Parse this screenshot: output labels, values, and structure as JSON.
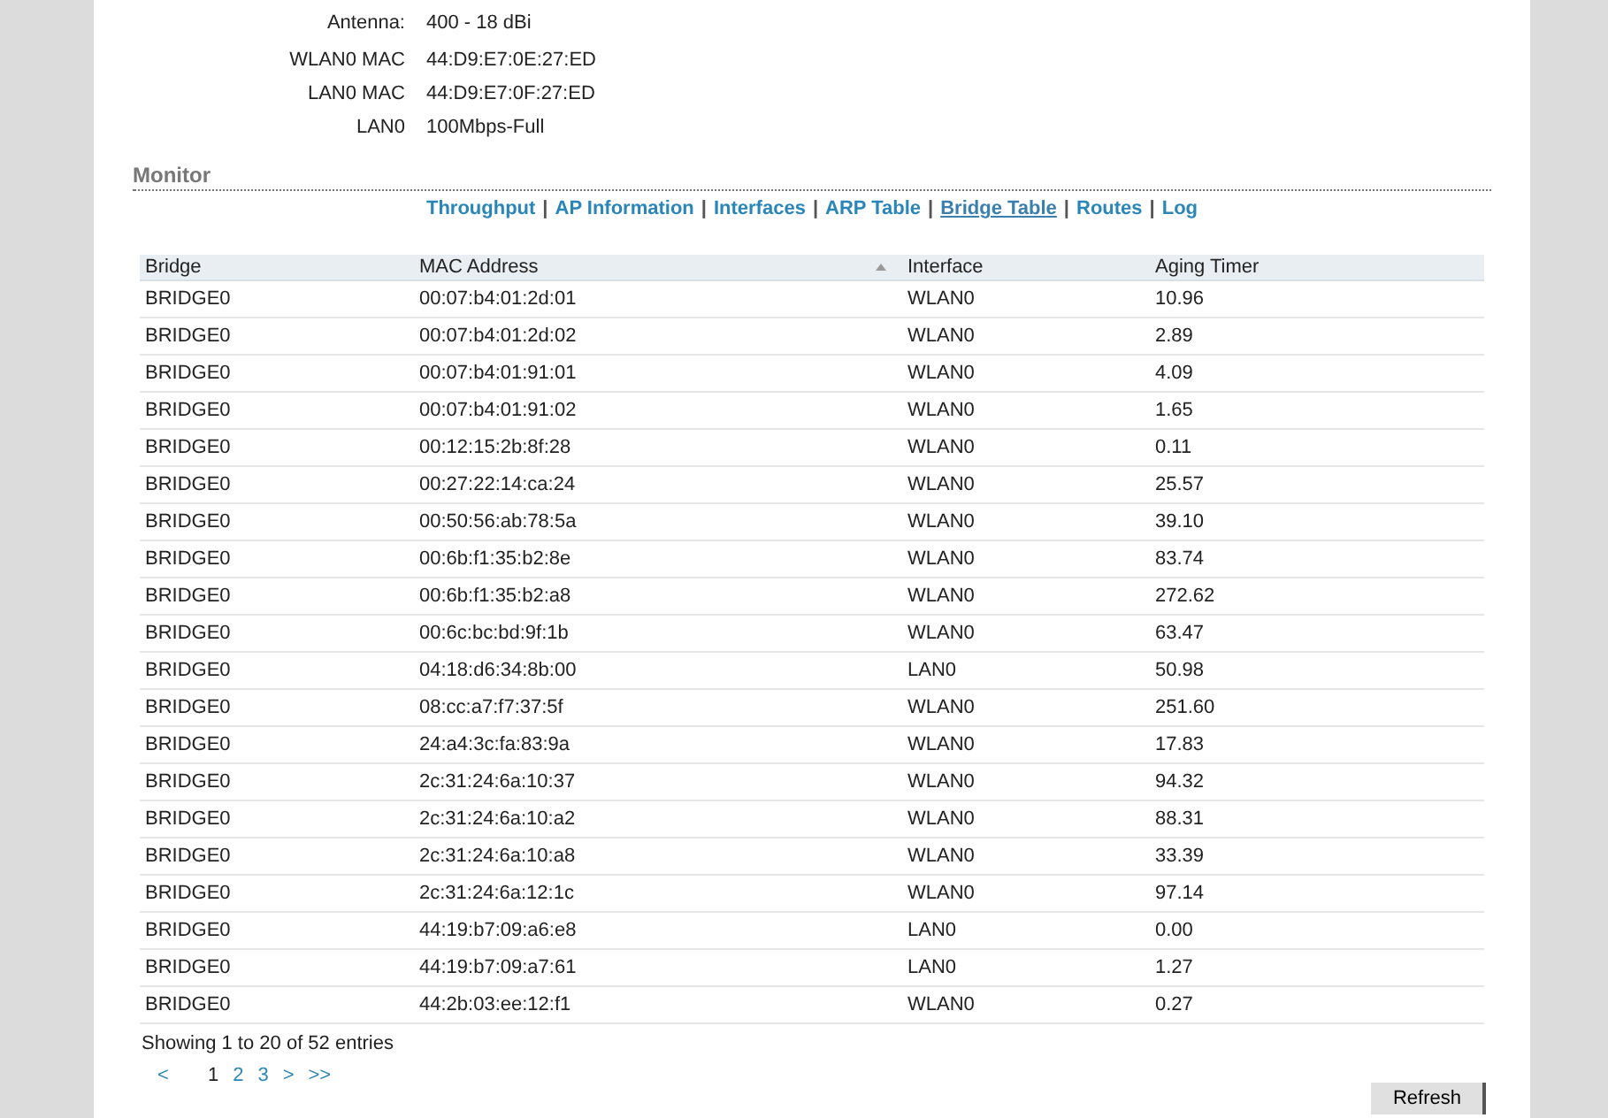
{
  "info": [
    {
      "label": "Antenna:",
      "value": "400 - 18 dBi"
    },
    {
      "label": "WLAN0 MAC",
      "value": "44:D9:E7:0E:27:ED"
    },
    {
      "label": "LAN0 MAC",
      "value": "44:D9:E7:0F:27:ED"
    },
    {
      "label": "LAN0",
      "value": "100Mbps-Full"
    }
  ],
  "section_title": "Monitor",
  "tabs": [
    {
      "label": "Throughput",
      "selected": false
    },
    {
      "label": "AP Information",
      "selected": false
    },
    {
      "label": "Interfaces",
      "selected": false
    },
    {
      "label": "ARP Table",
      "selected": false
    },
    {
      "label": "Bridge Table",
      "selected": true
    },
    {
      "label": "Routes",
      "selected": false
    },
    {
      "label": "Log",
      "selected": false
    }
  ],
  "separator": "|",
  "table": {
    "columns": [
      {
        "label": "Bridge",
        "sorted": false
      },
      {
        "label": "MAC Address",
        "sorted": true
      },
      {
        "label": "Interface",
        "sorted": false
      },
      {
        "label": "Aging Timer",
        "sorted": false
      }
    ],
    "rows": [
      [
        "BRIDGE0",
        "00:07:b4:01:2d:01",
        "WLAN0",
        "10.96"
      ],
      [
        "BRIDGE0",
        "00:07:b4:01:2d:02",
        "WLAN0",
        "2.89"
      ],
      [
        "BRIDGE0",
        "00:07:b4:01:91:01",
        "WLAN0",
        "4.09"
      ],
      [
        "BRIDGE0",
        "00:07:b4:01:91:02",
        "WLAN0",
        "1.65"
      ],
      [
        "BRIDGE0",
        "00:12:15:2b:8f:28",
        "WLAN0",
        "0.11"
      ],
      [
        "BRIDGE0",
        "00:27:22:14:ca:24",
        "WLAN0",
        "25.57"
      ],
      [
        "BRIDGE0",
        "00:50:56:ab:78:5a",
        "WLAN0",
        "39.10"
      ],
      [
        "BRIDGE0",
        "00:6b:f1:35:b2:8e",
        "WLAN0",
        "83.74"
      ],
      [
        "BRIDGE0",
        "00:6b:f1:35:b2:a8",
        "WLAN0",
        "272.62"
      ],
      [
        "BRIDGE0",
        "00:6c:bc:bd:9f:1b",
        "WLAN0",
        "63.47"
      ],
      [
        "BRIDGE0",
        "04:18:d6:34:8b:00",
        "LAN0",
        "50.98"
      ],
      [
        "BRIDGE0",
        "08:cc:a7:f7:37:5f",
        "WLAN0",
        "251.60"
      ],
      [
        "BRIDGE0",
        "24:a4:3c:fa:83:9a",
        "WLAN0",
        "17.83"
      ],
      [
        "BRIDGE0",
        "2c:31:24:6a:10:37",
        "WLAN0",
        "94.32"
      ],
      [
        "BRIDGE0",
        "2c:31:24:6a:10:a2",
        "WLAN0",
        "88.31"
      ],
      [
        "BRIDGE0",
        "2c:31:24:6a:10:a8",
        "WLAN0",
        "33.39"
      ],
      [
        "BRIDGE0",
        "2c:31:24:6a:12:1c",
        "WLAN0",
        "97.14"
      ],
      [
        "BRIDGE0",
        "44:19:b7:09:a6:e8",
        "LAN0",
        "0.00"
      ],
      [
        "BRIDGE0",
        "44:19:b7:09:a7:61",
        "LAN0",
        "1.27"
      ],
      [
        "BRIDGE0",
        "44:2b:03:ee:12:f1",
        "WLAN0",
        "0.27"
      ]
    ]
  },
  "entries_info": "Showing 1 to 20 of 52 entries",
  "pagination": [
    {
      "label": "<",
      "selected": false
    },
    {
      "label": "1",
      "selected": true
    },
    {
      "label": "2",
      "selected": false
    },
    {
      "label": "3",
      "selected": false
    },
    {
      "label": ">",
      "selected": false
    },
    {
      "label": ">>",
      "selected": false
    }
  ],
  "refresh_button": "Refresh"
}
